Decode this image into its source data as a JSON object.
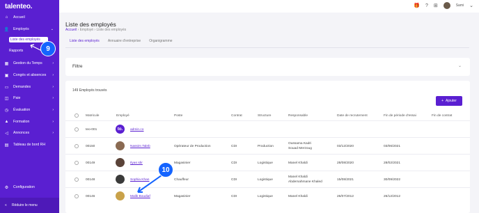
{
  "app": {
    "logo": "talenteo."
  },
  "sidebar": {
    "items": [
      {
        "label": "Accueil",
        "icon": "home-icon"
      },
      {
        "label": "Employés",
        "icon": "users-icon"
      },
      {
        "label": "Gestion du Temps",
        "icon": "calendar-icon"
      },
      {
        "label": "Congés et absences",
        "icon": "briefcase-icon"
      },
      {
        "label": "Demandes",
        "icon": "inbox-icon"
      },
      {
        "label": "Paie",
        "icon": "wallet-icon"
      },
      {
        "label": "Évaluation",
        "icon": "gauge-icon"
      },
      {
        "label": "Formation",
        "icon": "graduation-icon"
      },
      {
        "label": "Annonces",
        "icon": "megaphone-icon"
      },
      {
        "label": "Tableau de bord RH",
        "icon": "dashboard-icon"
      }
    ],
    "sub_items": [
      "Liste des employés",
      "Rapports"
    ],
    "settings": "Configuration",
    "collapse": "Réduire le menu"
  },
  "topbar": {
    "user": "Sami"
  },
  "header": {
    "title": "Liste des employés",
    "breadcrumb": [
      "Accueil",
      "Employé",
      "Liste des employés"
    ],
    "tabs": [
      "Liste des employés",
      "Annuaire d'entreprise",
      "Organigramme"
    ]
  },
  "filter": {
    "label": "Filtre"
  },
  "table": {
    "count_label": "149 Employés trouvés",
    "add_label": "Ajouter",
    "columns": [
      "Matricule",
      "Employé",
      "Poste",
      "Contrat",
      "Structure",
      "Responsable",
      "Date de recrutement",
      "Fin de période d'essai",
      "Fin de contrat"
    ],
    "rows": [
      {
        "matricule": "teo-001",
        "employe": "admin.co",
        "poste": "",
        "contrat": "",
        "structure": "",
        "responsable": "",
        "recrutement": "",
        "essai": "",
        "fin": ""
      },
      {
        "matricule": "00150",
        "employe": "Nassim Taleb",
        "poste": "Opérateur de Production",
        "contrat": "CDI",
        "structure": "Production",
        "responsable": "Oussama Kadri\nSouad Merzoug",
        "recrutement": "03/12/2020",
        "essai": "03/06/2021",
        "fin": ""
      },
      {
        "matricule": "00149",
        "employe": "Ilyas Idir",
        "poste": "Magasinier",
        "contrat": "CDI",
        "structure": "Logistique",
        "responsable": "Manel Khaldi",
        "recrutement": "28/08/2020",
        "essai": "28/02/2021",
        "fin": ""
      },
      {
        "matricule": "00148",
        "employe": "Sophia Khan",
        "poste": "Chauffeur",
        "contrat": "CDI",
        "structure": "Logistique",
        "responsable": "Manel Khaldi\nAbdemahmane Khaled",
        "recrutement": "15/08/2021",
        "essai": "30/09/2022",
        "fin": ""
      },
      {
        "matricule": "00146",
        "employe": "Malik Boudiaf",
        "poste": "Magasinier",
        "contrat": "CDI",
        "structure": "Logistique",
        "responsable": "Manel Khaldi",
        "recrutement": "26/07/2012",
        "essai": "26/12/2012",
        "fin": ""
      }
    ]
  },
  "badges": {
    "step_9": "9",
    "step_10": "10"
  },
  "colors": {
    "brand": "#5a1fd1",
    "badge": "#1464ff"
  }
}
